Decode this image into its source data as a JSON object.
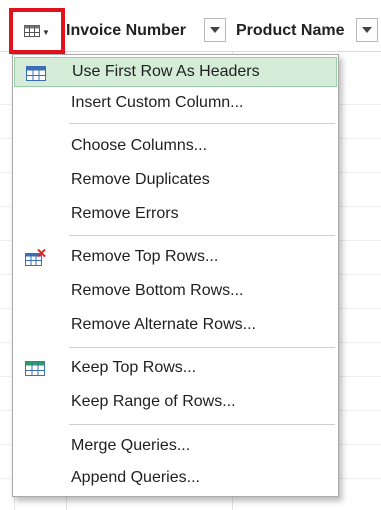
{
  "toolbar": {
    "corner_icon": "table-menu-icon",
    "highlight_color": "#e1121b"
  },
  "columns": [
    {
      "label": "Invoice Number"
    },
    {
      "label": "Product Name"
    }
  ],
  "menu": {
    "active_color": "#d5ecd9",
    "items": [
      {
        "label": "Use First Row As Headers",
        "icon": "use-headers-icon"
      },
      {
        "label": "Insert Custom Column..."
      },
      {
        "label": "Choose Columns..."
      },
      {
        "label": "Remove Duplicates"
      },
      {
        "label": "Remove Errors"
      },
      {
        "label": "Remove Top Rows...",
        "icon": "remove-rows-icon"
      },
      {
        "label": "Remove Bottom Rows..."
      },
      {
        "label": "Remove Alternate Rows..."
      },
      {
        "label": "Keep Top Rows...",
        "icon": "keep-rows-icon"
      },
      {
        "label": "Keep Range of Rows..."
      },
      {
        "label": "Merge Queries..."
      },
      {
        "label": "Append Queries..."
      }
    ]
  }
}
